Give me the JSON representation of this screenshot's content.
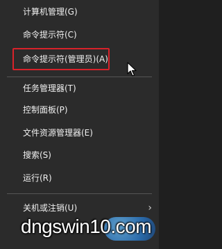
{
  "menu": {
    "items": [
      {
        "label": "计算机管理(G)"
      },
      {
        "label": "命令提示符(C)"
      },
      {
        "label": "命令提示符(管理员)(A)"
      },
      {
        "label": "任务管理器(T)"
      },
      {
        "label": "控制面板(P)"
      },
      {
        "label": "文件资源管理器(E)"
      },
      {
        "label": "搜索(S)"
      },
      {
        "label": "运行(R)"
      },
      {
        "label": "关机或注销(U)"
      }
    ],
    "submenu_indicator": "›"
  },
  "watermark": {
    "text": "dngswin10.com"
  },
  "colors": {
    "menu_background": "#2b2b2b",
    "highlight_border": "#d9222a",
    "text": "#f0f0f0",
    "separator": "#555555"
  }
}
